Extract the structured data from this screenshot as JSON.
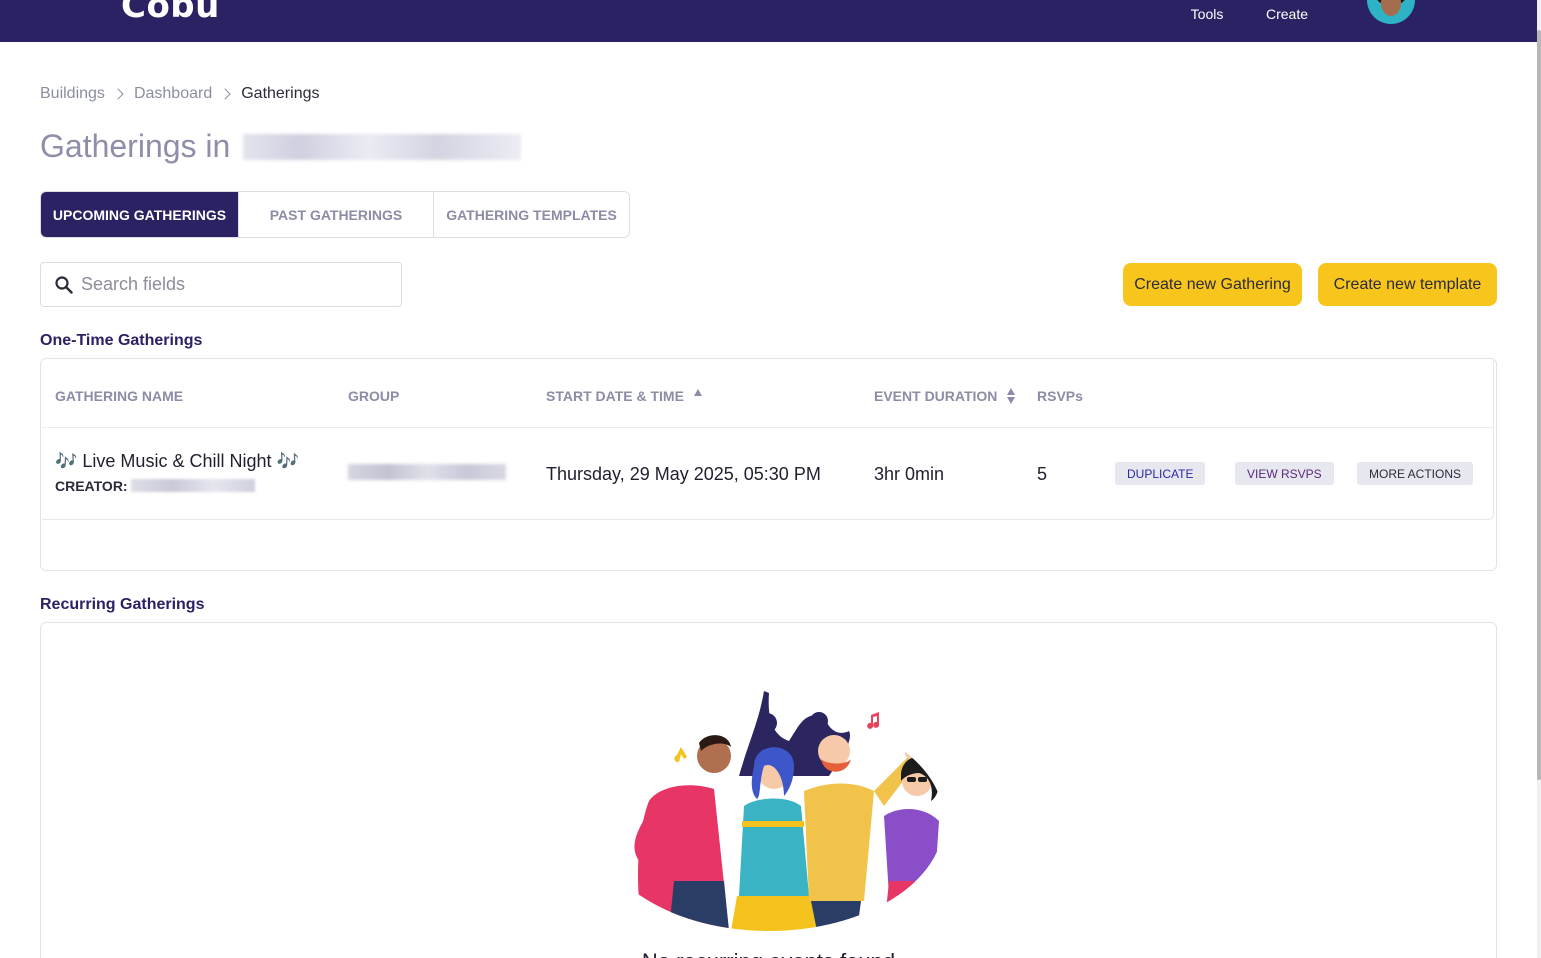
{
  "nav": {
    "logo": "Cobu",
    "items": [
      {
        "label": "Tools",
        "icon": "tools-icon"
      },
      {
        "label": "Create",
        "icon": "create-icon"
      }
    ],
    "avatar": "user-avatar"
  },
  "breadcrumb": {
    "items": [
      "Buildings",
      "Dashboard",
      "Gatherings"
    ]
  },
  "page": {
    "title_prefix": "Gatherings in"
  },
  "tabs": [
    {
      "label": "UPCOMING GATHERINGS",
      "active": true
    },
    {
      "label": "PAST GATHERINGS",
      "active": false
    },
    {
      "label": "GATHERING TEMPLATES",
      "active": false
    }
  ],
  "search": {
    "placeholder": "Search fields",
    "value": ""
  },
  "actions": {
    "create_gathering": "Create new Gathering",
    "create_template": "Create new template"
  },
  "one_time": {
    "section_title": "One-Time Gatherings",
    "columns": {
      "name": "GATHERING NAME",
      "group": "GROUP",
      "start": "START DATE & TIME",
      "duration": "EVENT DURATION",
      "rsvps": "RSVPs"
    },
    "rows": [
      {
        "name": "🎶 Live Music & Chill Night 🎶",
        "creator_label": "CREATOR:",
        "start": "Thursday, 29 May 2025, 05:30 PM",
        "duration": "3hr 0min",
        "rsvps": "5",
        "actions": {
          "duplicate": "DUPLICATE",
          "view_rsvps": "VIEW RSVPS",
          "more": "MORE ACTIONS"
        }
      }
    ]
  },
  "recurring": {
    "section_title": "Recurring Gatherings",
    "empty_text": "No recurring events found"
  },
  "colors": {
    "nav_bg": "#2b2264",
    "accent_yellow": "#f8c51c",
    "tab_active_bg": "#2b2264"
  }
}
